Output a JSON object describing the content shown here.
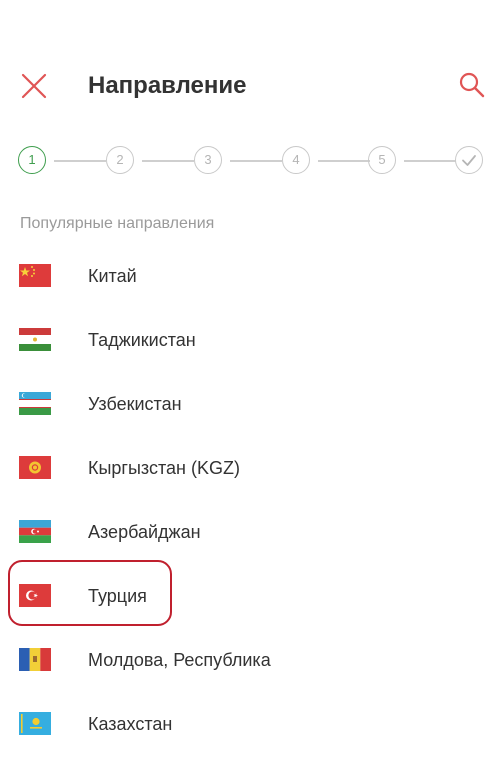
{
  "header": {
    "title": "Направление",
    "close_icon": "close-icon",
    "search_icon": "search-icon"
  },
  "stepper": {
    "steps": [
      "1",
      "2",
      "3",
      "4",
      "5"
    ],
    "final_icon": "check-icon",
    "active_index": 0,
    "active_color": "#3f9e4e"
  },
  "section": {
    "label": "Популярные направления"
  },
  "countries": [
    {
      "name": "Китай",
      "flag": "china-flag"
    },
    {
      "name": "Таджикистан",
      "flag": "tajikistan-flag"
    },
    {
      "name": "Узбекистан",
      "flag": "uzbekistan-flag"
    },
    {
      "name": "Кыргызстан (KGZ)",
      "flag": "kyrgyzstan-flag"
    },
    {
      "name": "Азербайджан",
      "flag": "azerbaijan-flag"
    },
    {
      "name": "Турция",
      "flag": "turkey-flag",
      "highlighted": true
    },
    {
      "name": "Молдова, Республика",
      "flag": "moldova-flag"
    },
    {
      "name": "Казахстан",
      "flag": "kazakhstan-flag"
    }
  ],
  "colors": {
    "accent": "#e05555",
    "highlight_border": "#c0202e",
    "text": "#333333",
    "muted": "#9a9a9a"
  }
}
